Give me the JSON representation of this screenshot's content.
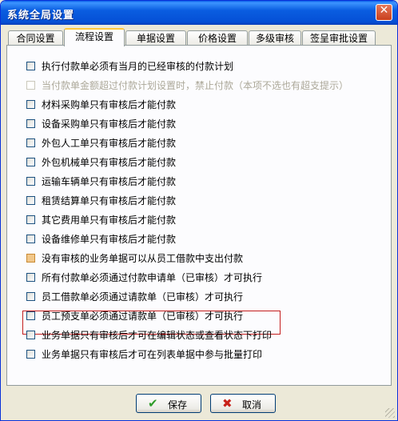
{
  "window": {
    "title": "系统全局设置"
  },
  "tabs": [
    {
      "label": "合同设置"
    },
    {
      "label": "流程设置"
    },
    {
      "label": "单据设置"
    },
    {
      "label": "价格设置"
    },
    {
      "label": "多级审核"
    },
    {
      "label": "签呈审批设置"
    }
  ],
  "options": [
    {
      "label": "执行付款单必须有当月的已经审核的付款计划",
      "checked": false
    },
    {
      "label": "当付款单金额超过付款计划设置时，禁止付款（本项不选也有超支提示）",
      "checked": false,
      "disabled": true
    },
    {
      "label": "材料采购单只有审核后才能付款",
      "checked": false
    },
    {
      "label": "设备采购单只有审核后才能付款",
      "checked": false
    },
    {
      "label": "外包人工单只有审核后才能付款",
      "checked": false
    },
    {
      "label": "外包机械单只有审核后才能付款",
      "checked": false
    },
    {
      "label": "运输车辆单只有审核后才能付款",
      "checked": false
    },
    {
      "label": "租赁结算单只有审核后才能付款",
      "checked": false
    },
    {
      "label": "其它费用单只有审核后才能付款",
      "checked": false
    },
    {
      "label": "设备维修单只有审核后才能付款",
      "checked": false
    },
    {
      "label": "没有审核的业务单据可以从员工借款中支出付款",
      "checked": false
    },
    {
      "label": "所有付款单必须通过付款申请单（已审核）才可执行",
      "checked": false
    },
    {
      "label": "员工借款单必须通过请款单（已审核）才可执行",
      "checked": false
    },
    {
      "label": "员工预支单必须通过请款单（已审核）才可执行",
      "checked": false
    },
    {
      "label": "业务单据只有审核后才可在编辑状态或查看状态下打印",
      "checked": false
    },
    {
      "label": "业务单据只有审核后才可在列表单据中参与批量打印",
      "checked": false
    }
  ],
  "buttons": {
    "save_label": "保存",
    "cancel_label": "取消"
  },
  "icons": {
    "save": "check-icon",
    "cancel": "x-icon",
    "close": "close-icon"
  },
  "colors": {
    "highlight_border": "#c41e1e",
    "titlebar": "#0a5de0",
    "active_tab_accent": "#ffc83c"
  }
}
